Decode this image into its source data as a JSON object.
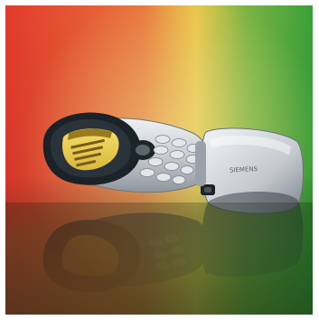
{
  "photo": {
    "subject": "mobile-phone",
    "brand_text": "SIEMENS",
    "colors": {
      "background_top_left": "#e8402e",
      "background_center": "#f0c040",
      "background_right": "#3fa83a",
      "background_bottom": "#2a6a2a",
      "phone_body": "#cfd3d8",
      "phone_bezel": "#1d242a",
      "screen": "#e9d25a",
      "screen_header": "#8a6a10"
    }
  }
}
